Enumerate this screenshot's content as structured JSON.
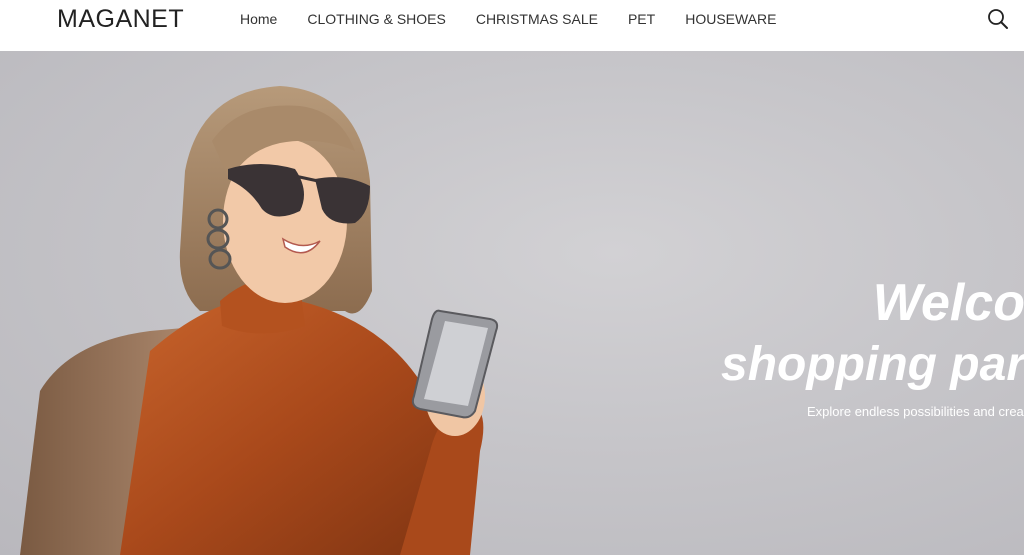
{
  "header": {
    "logo": "MAGANET",
    "nav": [
      {
        "label": "Home"
      },
      {
        "label": "CLOTHING & SHOES"
      },
      {
        "label": "CHRISTMAS SALE"
      },
      {
        "label": "PET"
      },
      {
        "label": "HOUSEWARE"
      }
    ],
    "search_icon": "search-icon"
  },
  "hero": {
    "title_line1": "Welco",
    "title_line2": "shopping par",
    "subtitle": "Explore endless possibilities and crea"
  }
}
